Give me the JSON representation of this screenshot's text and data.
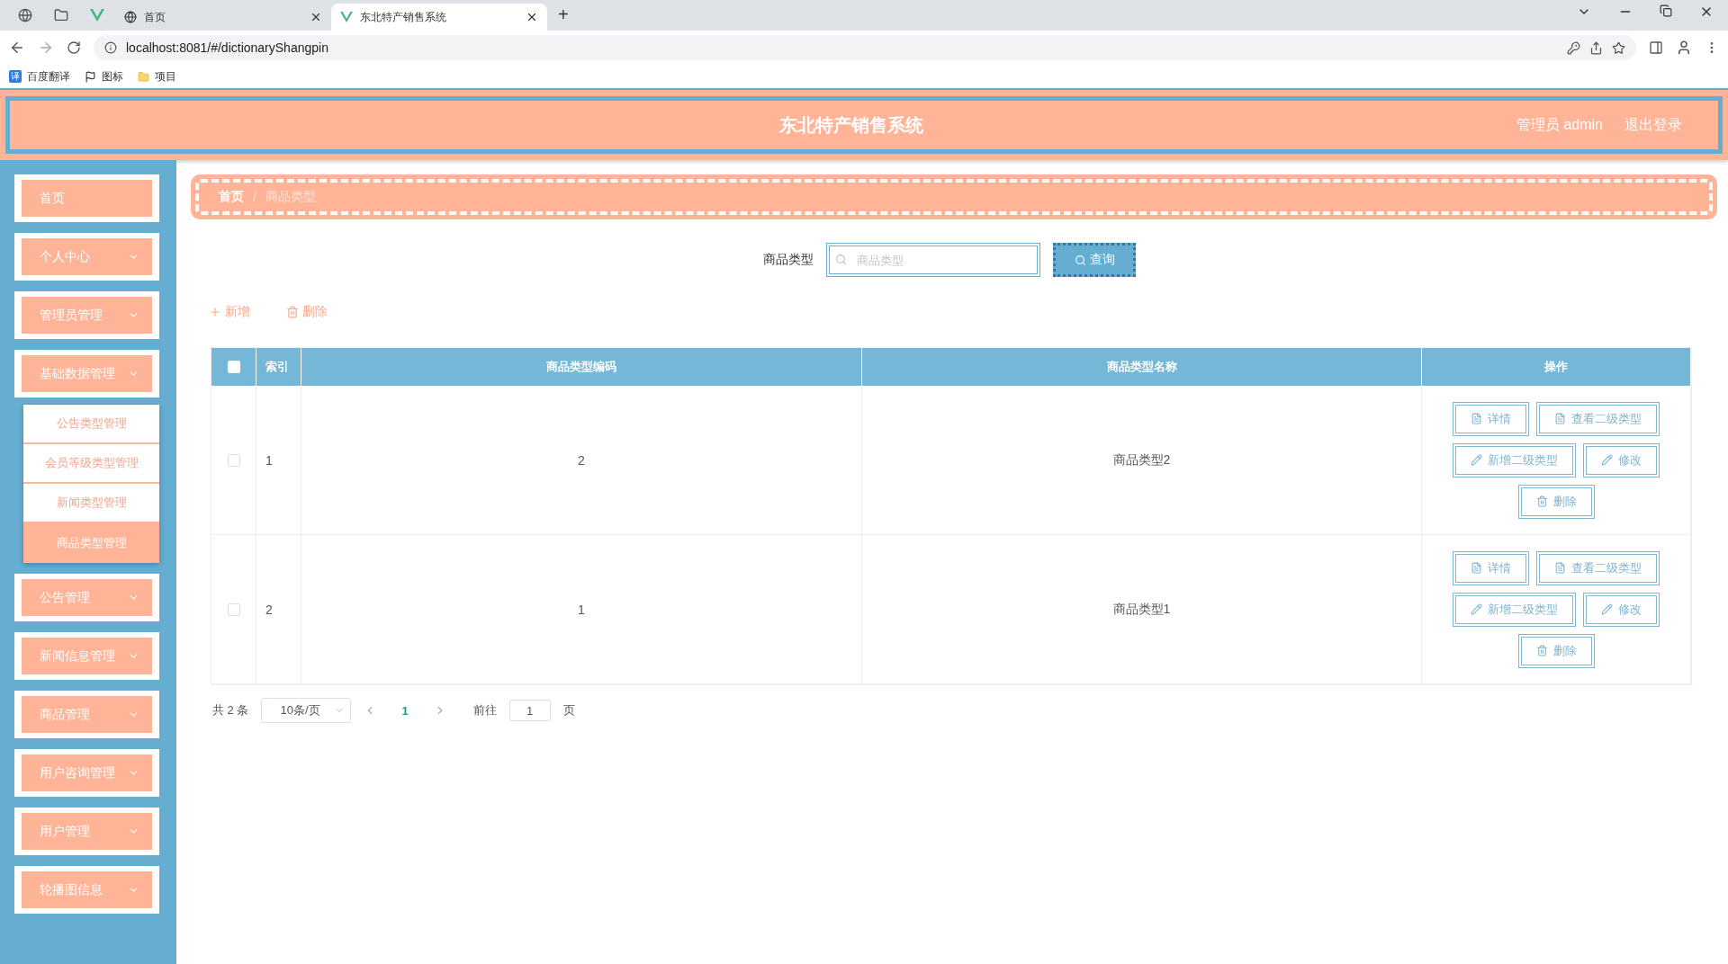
{
  "browser": {
    "tabs": [
      {
        "title": "首页",
        "selected": false
      },
      {
        "title": "东北特产销售系统",
        "selected": true
      }
    ],
    "new_tab": "+",
    "url": "localhost:8081/#/dictionaryShangpin",
    "bookmarks": [
      {
        "label": "百度翻译",
        "icon": "译"
      },
      {
        "label": "图标"
      },
      {
        "label": "项目"
      }
    ]
  },
  "header": {
    "title": "东北特产销售系统",
    "user": "管理员 admin",
    "logout": "退出登录"
  },
  "sidebar": {
    "items": [
      {
        "label": "首页",
        "kind": "link"
      },
      {
        "label": "个人中心",
        "kind": "submenu"
      },
      {
        "label": "管理员管理",
        "kind": "submenu"
      },
      {
        "label": "基础数据管理",
        "kind": "submenu",
        "expanded": true,
        "children": [
          {
            "label": "公告类型管理",
            "selected": false
          },
          {
            "label": "会员等级类型管理",
            "selected": false
          },
          {
            "label": "新闻类型管理",
            "selected": false
          },
          {
            "label": "商品类型管理",
            "selected": true
          }
        ]
      },
      {
        "label": "公告管理",
        "kind": "submenu"
      },
      {
        "label": "新闻信息管理",
        "kind": "submenu"
      },
      {
        "label": "商品管理",
        "kind": "submenu"
      },
      {
        "label": "用户咨询管理",
        "kind": "submenu"
      },
      {
        "label": "用户管理",
        "kind": "submenu"
      },
      {
        "label": "轮播图信息",
        "kind": "submenu"
      }
    ]
  },
  "breadcrumb": [
    "首页",
    "/",
    "商品类型"
  ],
  "search": {
    "label": "商品类型",
    "placeholder": "商品类型",
    "button": "查询"
  },
  "toolbar": [
    {
      "label": "新增",
      "kind": "add"
    },
    {
      "label": "删除",
      "kind": "delete"
    }
  ],
  "table": {
    "select_all_checked": false,
    "columns": [
      "索引",
      "商品类型编码",
      "商品类型名称",
      "操作"
    ],
    "rows": [
      {
        "checked": false,
        "index": "1",
        "code": "2",
        "name": "商品类型2",
        "actions": [
          {
            "label": "详情",
            "kind": "doc"
          },
          {
            "label": "查看二级类型",
            "kind": "doc"
          },
          {
            "label": "新增二级类型",
            "kind": "edit"
          },
          {
            "label": "修改",
            "kind": "edit"
          },
          {
            "label": "删除",
            "kind": "delete"
          }
        ]
      },
      {
        "checked": false,
        "index": "2",
        "code": "1",
        "name": "商品类型1",
        "actions": [
          {
            "label": "详情",
            "kind": "doc"
          },
          {
            "label": "查看二级类型",
            "kind": "doc"
          },
          {
            "label": "新增二级类型",
            "kind": "edit"
          },
          {
            "label": "修改",
            "kind": "edit"
          },
          {
            "label": "删除",
            "kind": "delete"
          }
        ]
      }
    ]
  },
  "pagination": {
    "total": "共 2 条",
    "page_size": "10条/页",
    "pages": [
      {
        "label": "1",
        "selected": true
      }
    ],
    "goto": "前往",
    "goto_value": "1",
    "goto_suffix": "页"
  }
}
